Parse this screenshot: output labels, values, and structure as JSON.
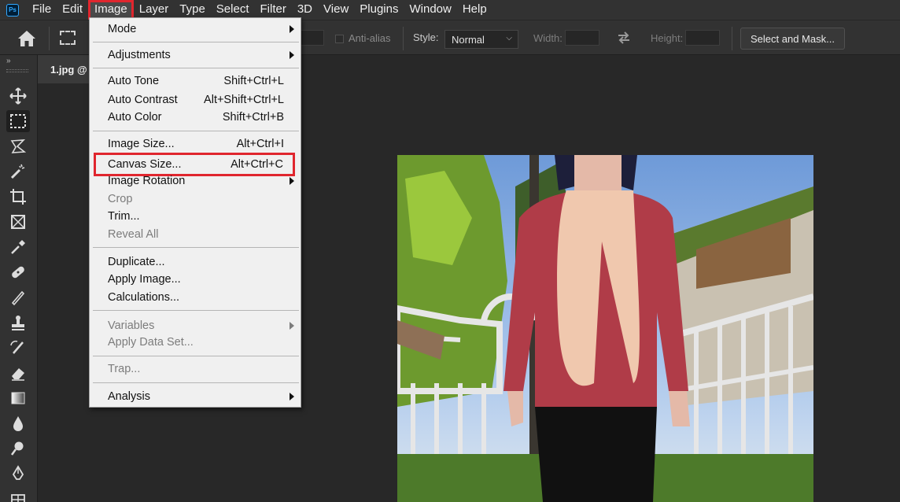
{
  "app": {
    "logo": "Ps"
  },
  "menubar": {
    "items": [
      "File",
      "Edit",
      "Image",
      "Layer",
      "Type",
      "Select",
      "Filter",
      "3D",
      "View",
      "Plugins",
      "Window",
      "Help"
    ],
    "active": "Image"
  },
  "options": {
    "anti_alias_label": "Anti-alias",
    "style_label": "Style:",
    "style_value": "Normal",
    "width_label": "Width:",
    "height_label": "Height:",
    "select_mask_label": "Select and Mask..."
  },
  "toolbar": {
    "collapse": "»",
    "tools": [
      "move-tool-icon",
      "marquee-tool-icon",
      "lasso-tool-icon",
      "magic-wand-tool-icon",
      "crop-tool-icon",
      "frame-tool-icon",
      "eyedropper-tool-icon",
      "healing-brush-tool-icon",
      "brush-tool-icon",
      "clone-stamp-tool-icon",
      "history-brush-tool-icon",
      "eraser-tool-icon",
      "gradient-tool-icon",
      "blur-tool-icon",
      "dodge-tool-icon",
      "pen-tool-icon",
      "type-tool-icon"
    ],
    "selected": "marquee-tool-icon"
  },
  "document": {
    "tab_title": "1.jpg @"
  },
  "image_menu": {
    "items": [
      {
        "label": "Mode",
        "submenu": true
      },
      {
        "label": "Adjustments",
        "submenu": true
      },
      {
        "label": "Auto Tone",
        "shortcut": "Shift+Ctrl+L"
      },
      {
        "label": "Auto Contrast",
        "shortcut": "Alt+Shift+Ctrl+L"
      },
      {
        "label": "Auto Color",
        "shortcut": "Shift+Ctrl+B"
      },
      {
        "label": "Image Size...",
        "shortcut": "Alt+Ctrl+I"
      },
      {
        "label": "Canvas Size...",
        "shortcut": "Alt+Ctrl+C",
        "highlighted": true
      },
      {
        "label": "Image Rotation",
        "submenu": true
      },
      {
        "label": "Crop",
        "disabled": true
      },
      {
        "label": "Trim..."
      },
      {
        "label": "Reveal All",
        "disabled": true
      },
      {
        "label": "Duplicate..."
      },
      {
        "label": "Apply Image..."
      },
      {
        "label": "Calculations..."
      },
      {
        "label": "Variables",
        "submenu": true,
        "disabled": true
      },
      {
        "label": "Apply Data Set...",
        "disabled": true
      },
      {
        "label": "Trap...",
        "disabled": true
      },
      {
        "label": "Analysis",
        "submenu": true
      }
    ]
  },
  "colors": {
    "highlight": "#e0262e",
    "menu_bg": "#f0f0f0",
    "ui_bg": "#323232",
    "canvas_bg": "#282828"
  }
}
